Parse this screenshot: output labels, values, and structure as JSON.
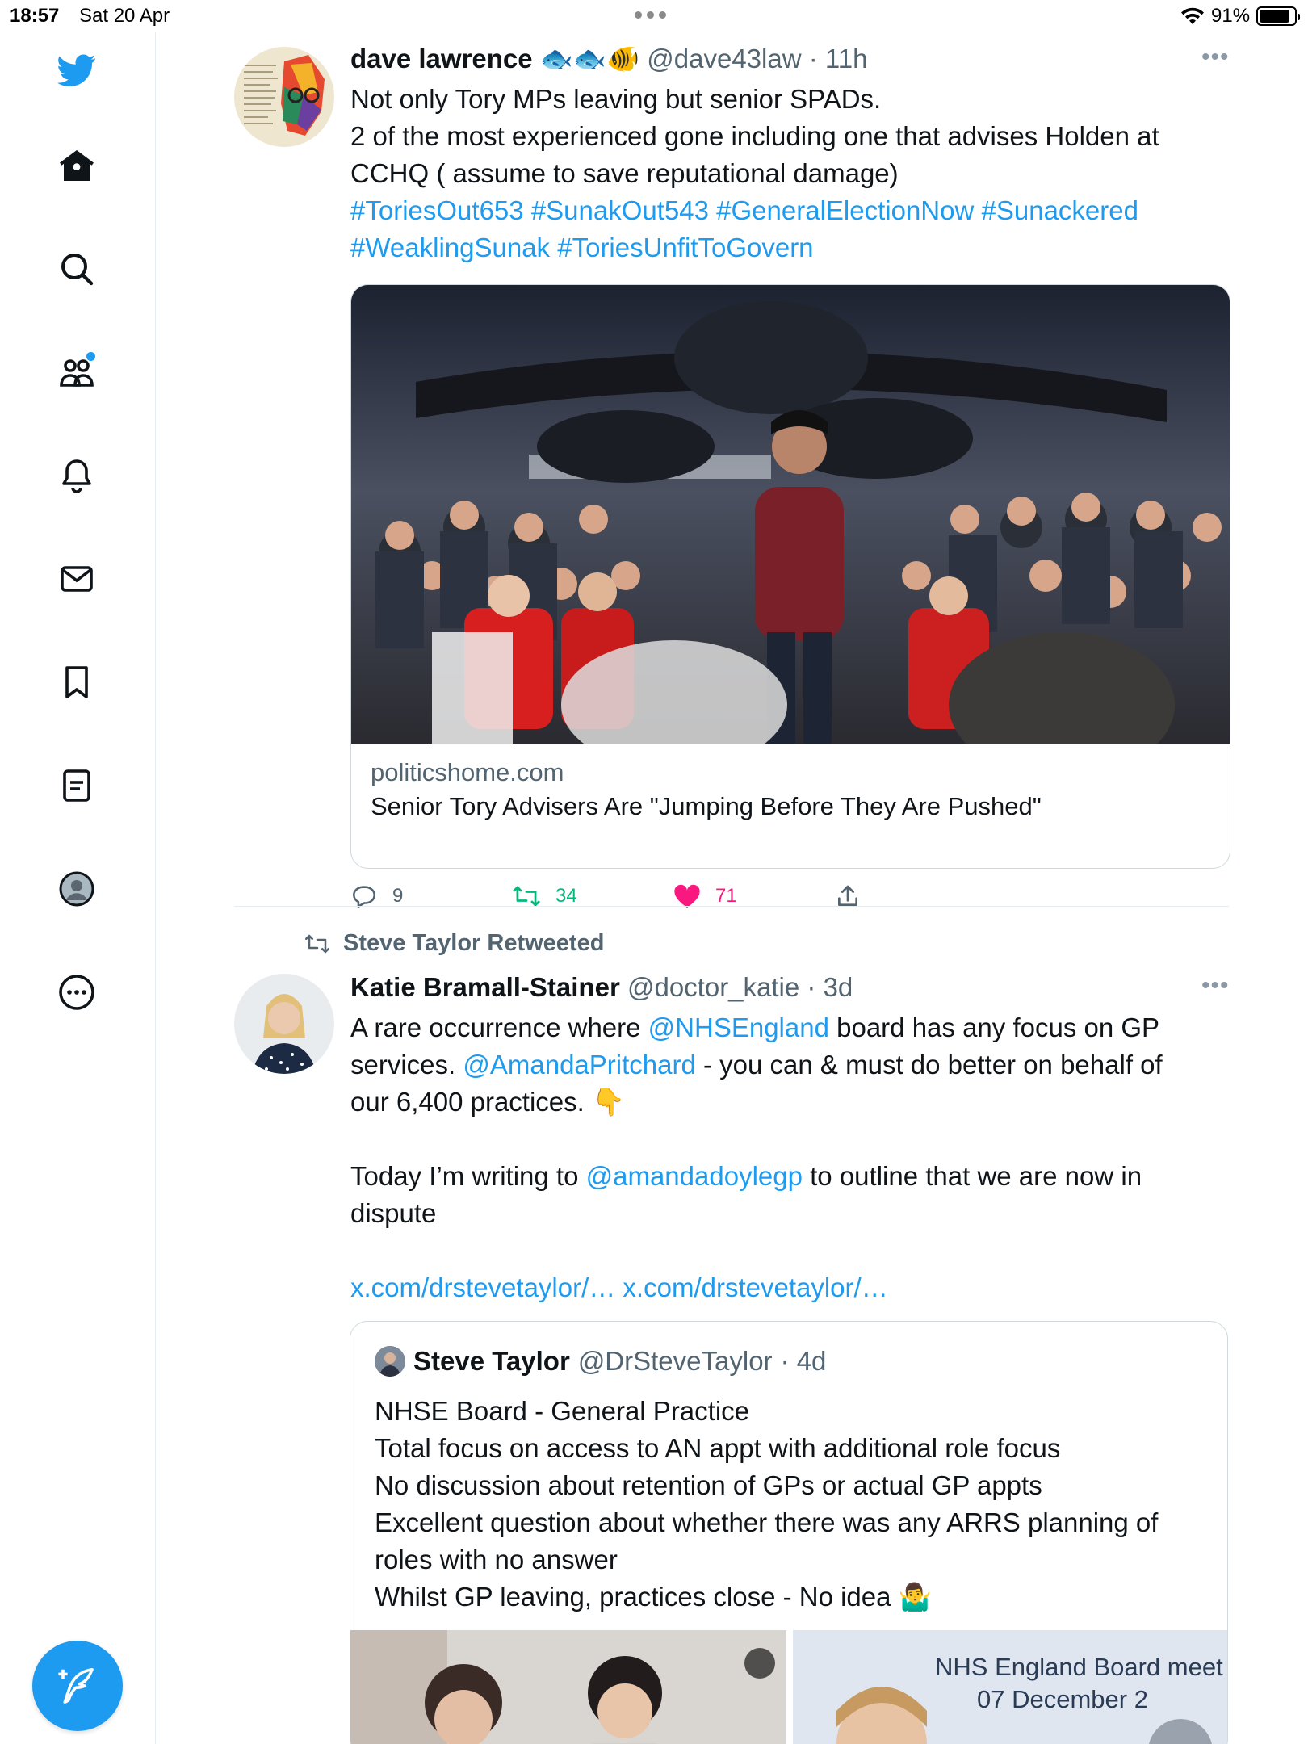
{
  "status_bar": {
    "time": "18:57",
    "date": "Sat 20 Apr",
    "battery": "91%"
  },
  "sidebar": {
    "items": [
      "twitter-logo",
      "home",
      "explore",
      "communities",
      "notifications",
      "messages",
      "bookmarks",
      "lists",
      "profile",
      "more"
    ]
  },
  "tweets": [
    {
      "name": "dave lawrence",
      "name_emoji": "🐟🐟🐠",
      "handle": "@dave43law",
      "time": "· 11h",
      "text_lines": [
        "Not only Tory MPs leaving but senior SPADs.",
        "2 of the most experienced gone including one that advises Holden at",
        "CCHQ ( assume to save reputational damage)"
      ],
      "hashtags": [
        "#ToriesOut653",
        "#SunakOut543",
        "#GeneralElectionNow",
        "#Sunackered",
        "#WeaklingSunak",
        "#ToriesUnfitToGovern"
      ],
      "card": {
        "domain": "politicshome.com",
        "title": "Senior Tory Advisers Are \"Jumping Before They Are Pushed\""
      },
      "actions": {
        "replies": "9",
        "retweets": "34",
        "likes": "71"
      }
    },
    {
      "retweeted_by": "Steve Taylor Retweeted",
      "name": "Katie Bramall-Stainer",
      "handle": "@doctor_katie",
      "time": "· 3d",
      "line1_pre": "A rare occurrence where ",
      "line1_mention": "@NHSEngland",
      "line1_post": " board has any focus on GP",
      "line2_pre": "services. ",
      "line2_mention": "@AmandaPritchard",
      "line2_post": " - you can & must do better on behalf of",
      "line3": "our 6,400 practices.",
      "line3_emoji": "👇",
      "line4_pre": "Today I’m writing to ",
      "line4_mention": "@amandadoylegp",
      "line4_post": " to outline that we are now in",
      "line5": "dispute",
      "links": "x.com/drstevetaylor/… x.com/drstevetaylor/…",
      "quote": {
        "name": "Steve Taylor",
        "handle": "@DrSteveTaylor",
        "time": "· 4d",
        "lines": [
          "NHSE Board - General Practice",
          "Total focus on access to AN appt with additional role focus",
          "No discussion about retention of GPs or actual GP appts",
          "Excellent question about whether there was any ARRS planning of",
          "roles with no answer",
          "Whilst GP leaving, practices close - No idea"
        ],
        "last_emoji": "🤷‍♂️",
        "media_caption_1": "NHS England Board meet",
        "media_caption_2": "07 December 2"
      }
    }
  ],
  "colors": {
    "accent": "#1d9bf0",
    "retweet": "#00ba7c",
    "like": "#f91880",
    "text": "#0f1419",
    "muted": "#536471"
  }
}
